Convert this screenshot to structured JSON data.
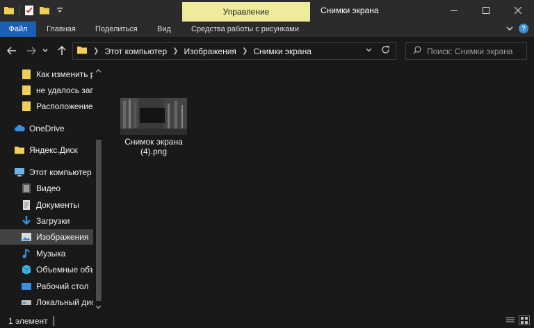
{
  "titlebar": {
    "contextual_tab": "Управление",
    "title": "Снимки экрана"
  },
  "ribbon": {
    "tabs": [
      "Файл",
      "Главная",
      "Поделиться",
      "Вид",
      "Средства работы с рисунками"
    ]
  },
  "address": {
    "crumbs": [
      "Этот компьютер",
      "Изображения",
      "Снимки экрана"
    ]
  },
  "search": {
    "placeholder": "Поиск: Снимки экрана"
  },
  "sidebar": {
    "items": [
      {
        "label": "Как изменить р",
        "icon": "folder-icon"
      },
      {
        "label": "не удалось запу",
        "icon": "folder-icon"
      },
      {
        "label": "Расположение",
        "icon": "folder-icon"
      },
      {
        "label": "OneDrive",
        "icon": "cloud-icon"
      },
      {
        "label": "Яндекс.Диск",
        "icon": "folder-icon"
      },
      {
        "label": "Этот компьютер",
        "icon": "computer-icon"
      },
      {
        "label": "Видео",
        "icon": "video-icon"
      },
      {
        "label": "Документы",
        "icon": "document-icon"
      },
      {
        "label": "Загрузки",
        "icon": "download-icon"
      },
      {
        "label": "Изображения",
        "icon": "pictures-icon",
        "selected": true
      },
      {
        "label": "Музыка",
        "icon": "music-icon"
      },
      {
        "label": "Объемные объ",
        "icon": "3d-objects-icon"
      },
      {
        "label": "Рабочий стол",
        "icon": "desktop-icon"
      },
      {
        "label": "Локальный дис",
        "icon": "drive-icon"
      }
    ]
  },
  "files": [
    {
      "name_line1": "Снимок экрана",
      "name_line2": "(4).png"
    }
  ],
  "status": {
    "count": "1 элемент"
  },
  "colors": {
    "accent": "#1a5fb4",
    "manage_tab": "#eeeb9b",
    "selection": "#434343",
    "folder": "#f3cd5a"
  }
}
